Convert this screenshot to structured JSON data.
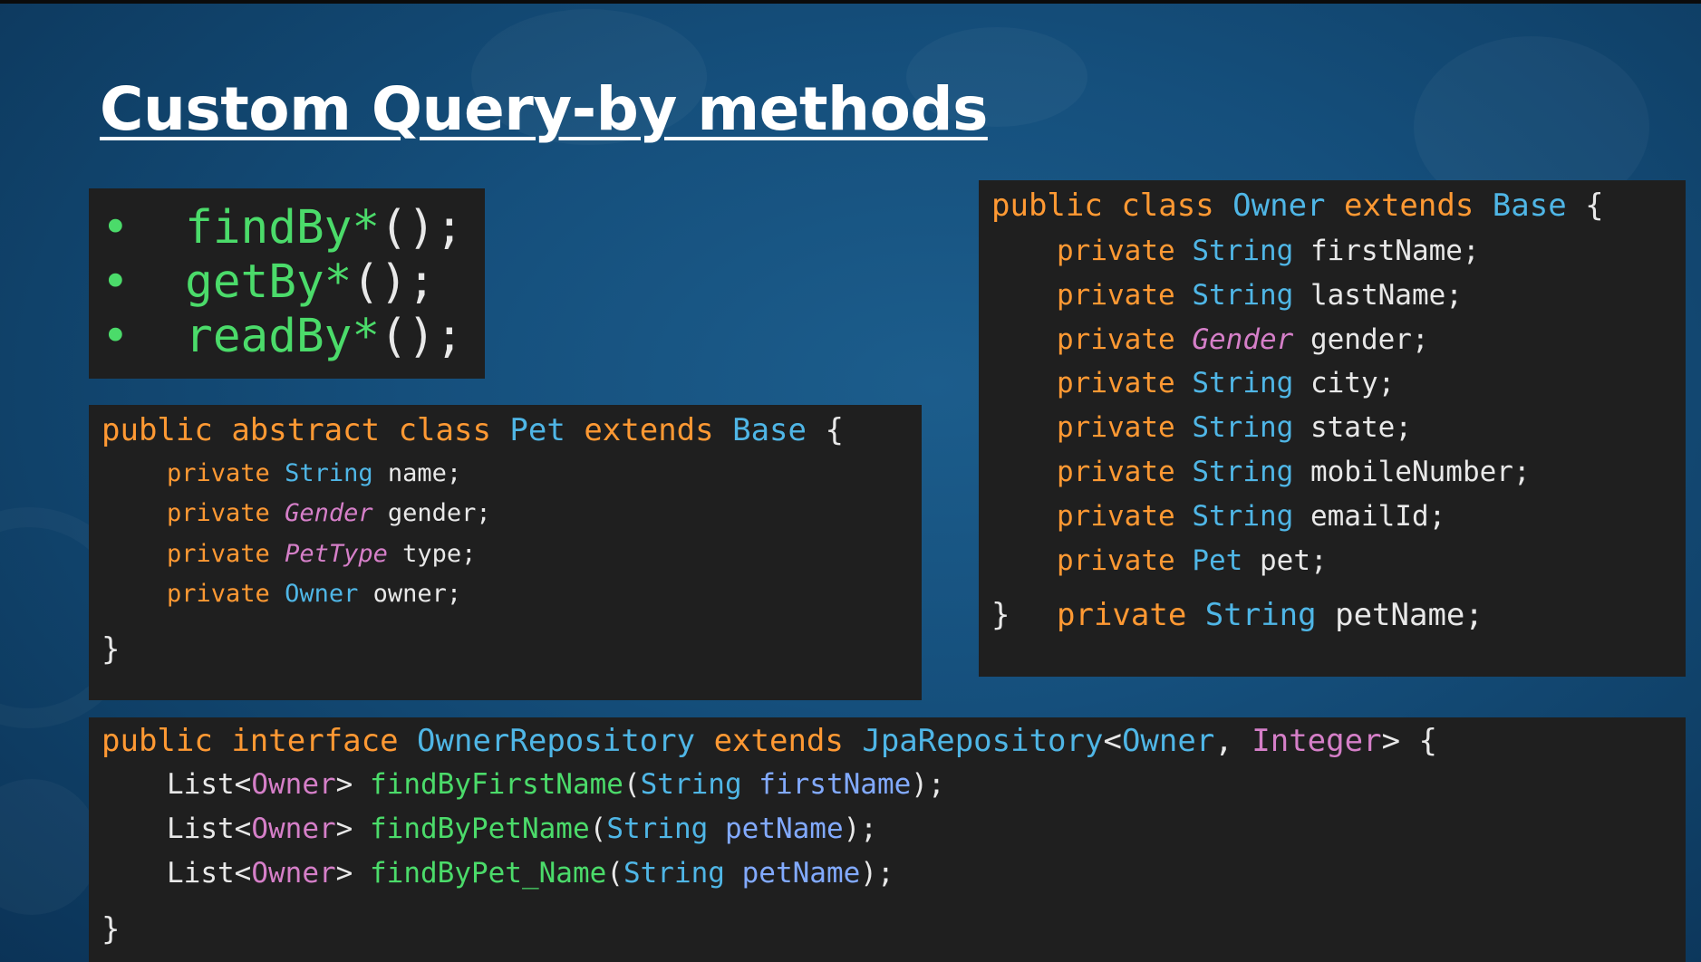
{
  "slide": {
    "title": "Custom Query-by methods"
  },
  "colors": {
    "keyword": "#ff9933",
    "type": "#4fb6e6",
    "italic_type": "#d57fc8",
    "method": "#4bdb6a",
    "identifier": "#e8e8e8",
    "parameter": "#82aaff",
    "panel_background": "#1f1f1f"
  },
  "methods_box": {
    "bullet": "•",
    "items": [
      {
        "name": "findBy",
        "suffix": "*",
        "punct": "();"
      },
      {
        "name": "getBy",
        "suffix": "*",
        "punct": "();"
      },
      {
        "name": "readBy",
        "suffix": "*",
        "punct": "();"
      }
    ]
  },
  "pet_class": {
    "kw_public": "public",
    "kw_abstract": "abstract",
    "kw_class": "class",
    "name": "Pet",
    "kw_extends": "extends",
    "base": "Base",
    "open": "{",
    "fields": [
      {
        "mod": "private",
        "type": "String",
        "name": "name",
        "punct": ";"
      },
      {
        "mod": "private",
        "type": "Gender",
        "name": "gender",
        "punct": ";"
      },
      {
        "mod": "private",
        "type": "PetType",
        "name": "type",
        "punct": ";"
      },
      {
        "mod": "private",
        "type": "Owner",
        "name": "owner",
        "punct": ";"
      }
    ],
    "close": "}"
  },
  "owner_class": {
    "kw_public": "public",
    "kw_class": "class",
    "name": "Owner",
    "kw_extends": "extends",
    "base": "Base",
    "open": "{",
    "fields": [
      {
        "mod": "private",
        "type": "String",
        "name": "firstName",
        "punct": ";"
      },
      {
        "mod": "private",
        "type": "String",
        "name": "lastName",
        "punct": ";"
      },
      {
        "mod": "private",
        "type": "Gender",
        "name": "gender",
        "punct": ";"
      },
      {
        "mod": "private",
        "type": "String",
        "name": "city",
        "punct": ";"
      },
      {
        "mod": "private",
        "type": "String",
        "name": "state",
        "punct": ";"
      },
      {
        "mod": "private",
        "type": "String",
        "name": "mobileNumber",
        "punct": ";"
      },
      {
        "mod": "private",
        "type": "String",
        "name": "emailId",
        "punct": ";"
      },
      {
        "mod": "private",
        "type": "Pet",
        "name": "pet",
        "punct": ";"
      }
    ],
    "close": "}",
    "extra_field": {
      "mod": "private",
      "type": "String",
      "name": "petName",
      "punct": ";"
    }
  },
  "repository": {
    "kw_public": "public",
    "kw_interface": "interface",
    "name": "OwnerRepository",
    "kw_extends": "extends",
    "base": "JpaRepository",
    "lt": "<",
    "type1": "Owner",
    "comma": ",",
    "type2": "Integer",
    "gt": ">",
    "open": "{",
    "methods": [
      {
        "ret": "List",
        "lt": "<",
        "ret_type": "Owner",
        "gt": ">",
        "name": "findByFirstName",
        "paren_open": "(",
        "param_type": "String",
        "param_name": "firstName",
        "paren_close": ");"
      },
      {
        "ret": "List",
        "lt": "<",
        "ret_type": "Owner",
        "gt": ">",
        "name": "findByPetName",
        "paren_open": "(",
        "param_type": "String",
        "param_name": "petName",
        "paren_close": ");"
      },
      {
        "ret": "List",
        "lt": "<",
        "ret_type": "Owner",
        "gt": ">",
        "name": "findByPet_Name",
        "paren_open": "(",
        "param_type": "String",
        "param_name": "petName",
        "paren_close": ");"
      }
    ],
    "close": "}"
  }
}
